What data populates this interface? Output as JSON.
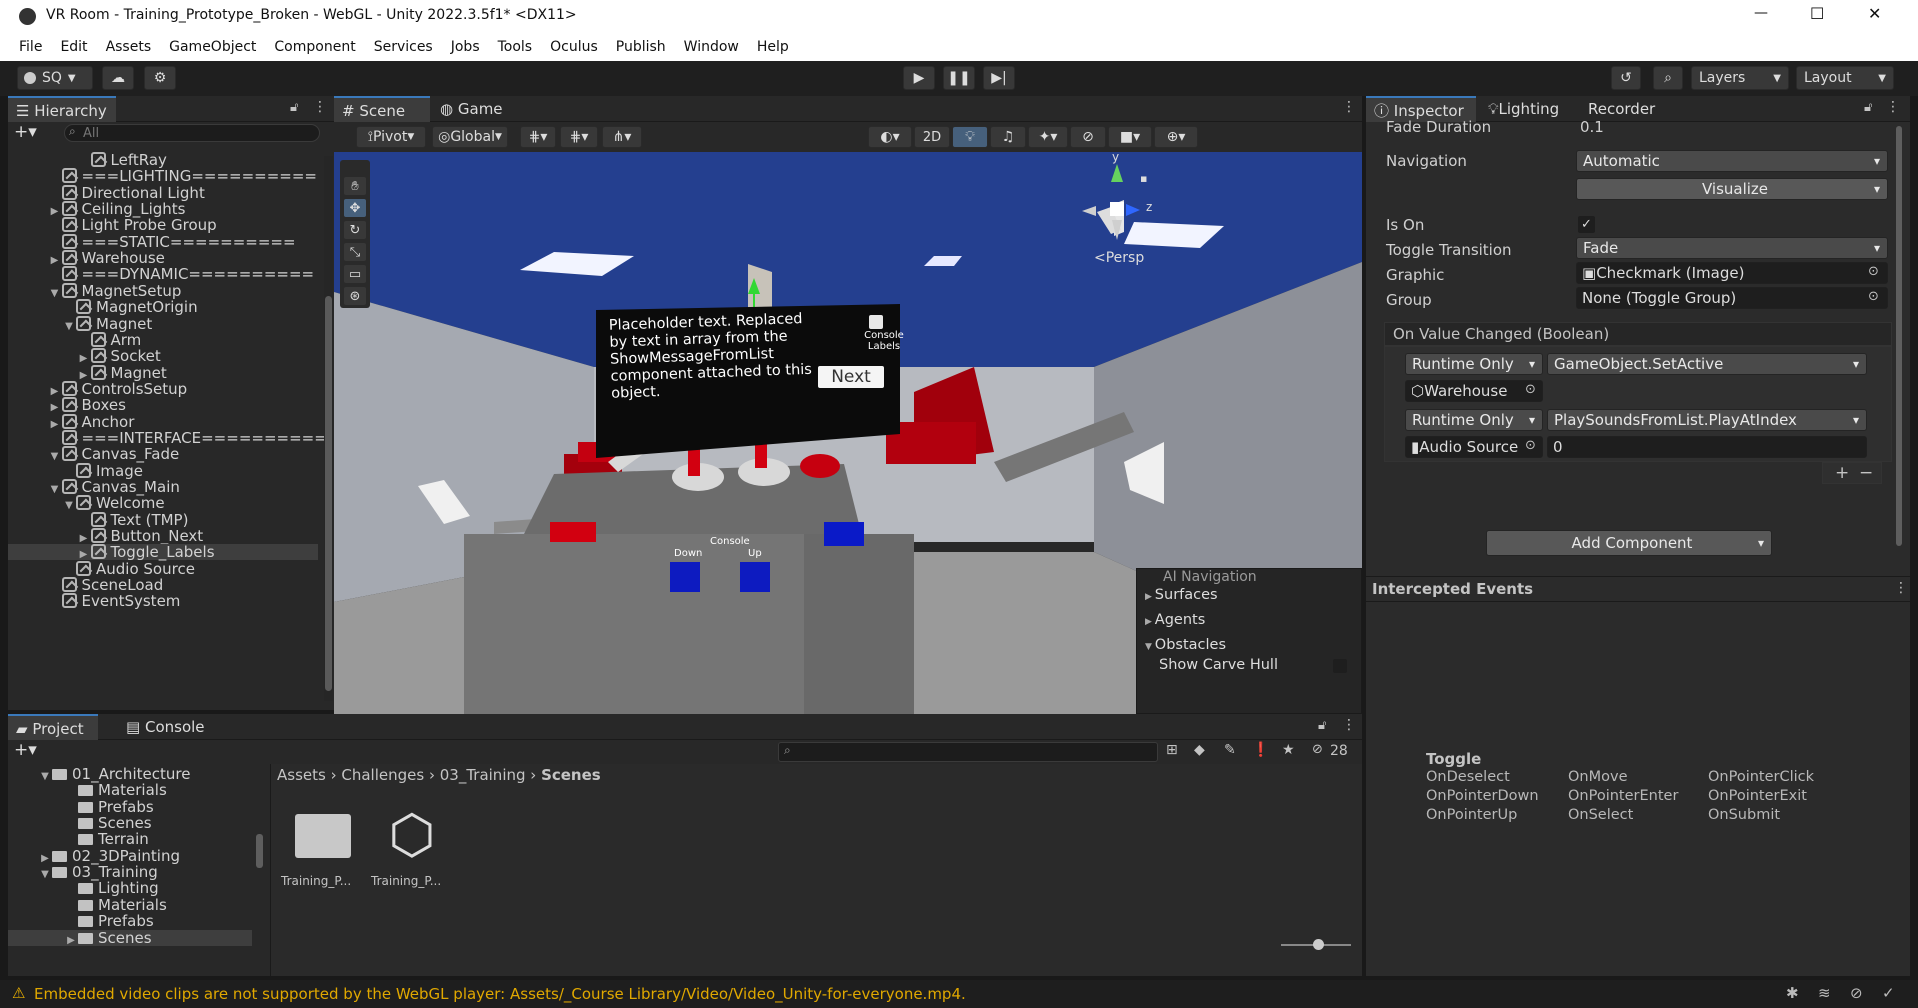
{
  "window": {
    "title": "VR Room - Training_Prototype_Broken - WebGL - Unity 2022.3.5f1* <DX11>",
    "controls": {
      "minimize": "—",
      "maximize": "☐",
      "close": "✕"
    }
  },
  "menu": [
    "File",
    "Edit",
    "Assets",
    "GameObject",
    "Component",
    "Services",
    "Jobs",
    "Tools",
    "Oculus",
    "Publish",
    "Window",
    "Help"
  ],
  "toolbar": {
    "account": "SQ",
    "layers": "Layers",
    "layout": "Layout",
    "play_icon": "play-icon",
    "pause_icon": "pause-icon",
    "step_icon": "step-icon"
  },
  "hierarchy": {
    "tab": "Hierarchy",
    "search_placeholder": "All",
    "items": [
      {
        "label": "LeftRay",
        "indent": 5,
        "arrow": ""
      },
      {
        "label": "===LIGHTING==========",
        "indent": 3,
        "arrow": ""
      },
      {
        "label": "Directional Light",
        "indent": 3,
        "arrow": ""
      },
      {
        "label": "Ceiling_Lights",
        "indent": 3,
        "arrow": "▶"
      },
      {
        "label": "Light Probe Group",
        "indent": 3,
        "arrow": ""
      },
      {
        "label": "===STATIC==========",
        "indent": 3,
        "arrow": ""
      },
      {
        "label": "Warehouse",
        "indent": 3,
        "arrow": "▶"
      },
      {
        "label": "===DYNAMIC==========",
        "indent": 3,
        "arrow": ""
      },
      {
        "label": "MagnetSetup",
        "indent": 3,
        "arrow": "▼"
      },
      {
        "label": "MagnetOrigin",
        "indent": 4,
        "arrow": ""
      },
      {
        "label": "Magnet",
        "indent": 4,
        "arrow": "▼"
      },
      {
        "label": "Arm",
        "indent": 5,
        "arrow": ""
      },
      {
        "label": "Socket",
        "indent": 5,
        "arrow": "▶"
      },
      {
        "label": "Magnet",
        "indent": 5,
        "arrow": "▶"
      },
      {
        "label": "ControlsSetup",
        "indent": 3,
        "arrow": "▶"
      },
      {
        "label": "Boxes",
        "indent": 3,
        "arrow": "▶"
      },
      {
        "label": "Anchor",
        "indent": 3,
        "arrow": "▶"
      },
      {
        "label": "===INTERFACE==========",
        "indent": 3,
        "arrow": ""
      },
      {
        "label": "Canvas_Fade",
        "indent": 3,
        "arrow": "▼"
      },
      {
        "label": "Image",
        "indent": 4,
        "arrow": ""
      },
      {
        "label": "Canvas_Main",
        "indent": 3,
        "arrow": "▼"
      },
      {
        "label": "Welcome",
        "indent": 4,
        "arrow": "▼"
      },
      {
        "label": "Text (TMP)",
        "indent": 5,
        "arrow": ""
      },
      {
        "label": "Button_Next",
        "indent": 5,
        "arrow": "▶"
      },
      {
        "label": "Toggle_Labels",
        "indent": 5,
        "arrow": "▶",
        "selected": true
      },
      {
        "label": "Audio Source",
        "indent": 4,
        "arrow": ""
      },
      {
        "label": "SceneLoad",
        "indent": 3,
        "arrow": ""
      },
      {
        "label": "EventSystem",
        "indent": 3,
        "arrow": ""
      }
    ]
  },
  "scene": {
    "tabs": [
      "Scene",
      "Game"
    ],
    "pivot": "Pivot",
    "global": "Global",
    "btn_2d": "2D",
    "persp": "<Persp",
    "gizmo_y": "y",
    "gizmo_z": "z",
    "canvas_text": "Placeholder text. Replaced by text in array from the ShowMessageFromList component attached to this object.",
    "console_labels": "Console\nLabels",
    "next_button": "Next",
    "console_label": "Console",
    "down_label": "Down",
    "up_label": "Up",
    "ai_nav": {
      "title": "AI Navigation",
      "items": [
        "Surfaces",
        "Agents",
        "Obstacles"
      ],
      "show_carve_hull": "Show Carve Hull"
    }
  },
  "inspector": {
    "tabs": [
      "Inspector",
      "Lighting",
      "Recorder"
    ],
    "fade_duration_label": "Fade Duration",
    "fade_duration_value": "0.1",
    "navigation_label": "Navigation",
    "navigation_value": "Automatic",
    "visualize": "Visualize",
    "is_on_label": "Is On",
    "toggle_transition_label": "Toggle Transition",
    "toggle_transition_value": "Fade",
    "graphic_label": "Graphic",
    "graphic_value": "Checkmark (Image)",
    "group_label": "Group",
    "group_value": "None (Toggle Group)",
    "on_value_changed": "On Value Changed (Boolean)",
    "events": [
      {
        "mode": "Runtime Only",
        "function": "GameObject.SetActive",
        "target": "Warehouse",
        "arg": ""
      },
      {
        "mode": "Runtime Only",
        "function": "PlaySoundsFromList.PlayAtIndex",
        "target": "Audio Source",
        "arg": "0"
      }
    ],
    "add_component": "Add Component"
  },
  "intercepted": {
    "title": "Intercepted Events",
    "section": "Toggle",
    "events": [
      "OnDeselect",
      "OnMove",
      "OnPointerClick",
      "OnPointerDown",
      "OnPointerEnter",
      "OnPointerExit",
      "OnPointerUp",
      "OnSelect",
      "OnSubmit"
    ]
  },
  "project": {
    "tabs": [
      "Project",
      "Console"
    ],
    "hidden_count": "28",
    "breadcrumb": [
      "Assets",
      "Challenges",
      "03_Training",
      "Scenes"
    ],
    "tree": [
      {
        "label": "01_Architecture",
        "indent": 1,
        "arrow": "▼"
      },
      {
        "label": "Materials",
        "indent": 2,
        "arrow": ""
      },
      {
        "label": "Prefabs",
        "indent": 2,
        "arrow": ""
      },
      {
        "label": "Scenes",
        "indent": 2,
        "arrow": ""
      },
      {
        "label": "Terrain",
        "indent": 2,
        "arrow": ""
      },
      {
        "label": "02_3DPainting",
        "indent": 1,
        "arrow": "▶"
      },
      {
        "label": "03_Training",
        "indent": 1,
        "arrow": "▼"
      },
      {
        "label": "Lighting",
        "indent": 2,
        "arrow": ""
      },
      {
        "label": "Materials",
        "indent": 2,
        "arrow": ""
      },
      {
        "label": "Prefabs",
        "indent": 2,
        "arrow": ""
      },
      {
        "label": "Scenes",
        "indent": 2,
        "arrow": "▶",
        "selected": true
      }
    ],
    "assets": [
      "Training_P...",
      "Training_P..."
    ]
  },
  "status": {
    "message": "Embedded video clips are not supported by the WebGL player: Assets/_Course Library/Video/Video_Unity-for-everyone.mp4."
  }
}
